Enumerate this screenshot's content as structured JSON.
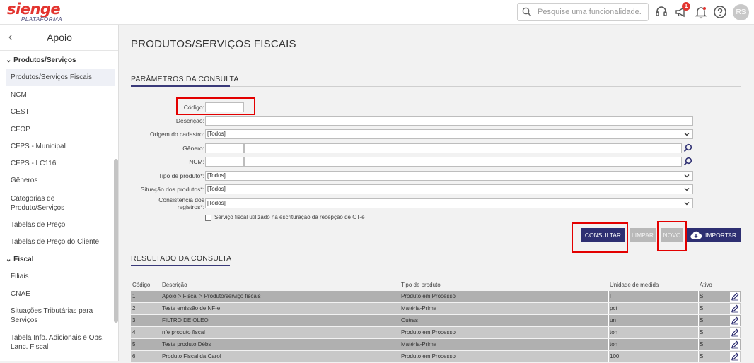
{
  "header": {
    "logo_main": "sienge",
    "logo_sub": "PLATAFORMA",
    "search_placeholder": "Pesquise uma funcionalidade.",
    "notification_count": "1",
    "user_initials": "RS"
  },
  "sidebar": {
    "title": "Apoio",
    "sections": [
      {
        "label": "Produtos/Serviços",
        "items": [
          "Produtos/Serviços Fiscais",
          "NCM",
          "CEST",
          "CFOP",
          "CFPS - Municipal",
          "CFPS - LC116",
          "Gêneros",
          "Categorias de Produto/Serviços",
          "Tabelas de Preço",
          "Tabelas de Preço do Cliente"
        ]
      },
      {
        "label": "Fiscal",
        "items": [
          "Filiais",
          "CNAE",
          "Situações Tributárias para Serviços",
          "Tabela Info. Adicionais e Obs. Lanc. Fiscal"
        ]
      }
    ]
  },
  "page": {
    "title": "PRODUTOS/SERVIÇOS FISCAIS",
    "params_title": "PARÂMETROS DA CONSULTA",
    "results_title": "RESULTADO DA CONSULTA"
  },
  "form": {
    "codigo_label": "Código:",
    "descricao_label": "Descrição:",
    "origem_label": "Origem do cadastro:",
    "origem_value": "[Todos]",
    "genero_label": "Gênero:",
    "ncm_label": "NCM:",
    "tipo_label": "Tipo de produto*:",
    "tipo_value": "[Todos]",
    "situacao_label": "Situação dos produtos*:",
    "situacao_value": "[Todos]",
    "consistencia_label": "Consistência dos registros*:",
    "consistencia_value": "[Todos]",
    "checkbox_label": "Serviço fiscal utilizado na escrituração da recepção de CT-e"
  },
  "buttons": {
    "consultar": "CONSULTAR",
    "limpar": "LIMPAR",
    "novo": "NOVO",
    "importar": "IMPORTAR"
  },
  "table": {
    "columns": [
      "Código",
      "Descrição",
      "Tipo de produto",
      "Unidade de medida",
      "Ativo"
    ],
    "rows": [
      {
        "codigo": "1",
        "descricao": "Apoio > Fiscal > Produto/serviço fiscais",
        "tipo": "Produto em Processo",
        "unidade": "l",
        "ativo": "S"
      },
      {
        "codigo": "2",
        "descricao": "Teste emissão de NF-e",
        "tipo": "Matéria-Prima",
        "unidade": "pct",
        "ativo": "S"
      },
      {
        "codigo": "3",
        "descricao": "FILTRO DE OLEO",
        "tipo": "Outras",
        "unidade": "un",
        "ativo": "S"
      },
      {
        "codigo": "4",
        "descricao": "nfe produto fiscal",
        "tipo": "Produto em Processo",
        "unidade": "ton",
        "ativo": "S"
      },
      {
        "codigo": "5",
        "descricao": "Teste produto Débs",
        "tipo": "Matéria-Prima",
        "unidade": "ton",
        "ativo": "S"
      },
      {
        "codigo": "6",
        "descricao": "Produto Fiscal da Carol",
        "tipo": "Produto em Processo",
        "unidade": "100",
        "ativo": "S"
      }
    ]
  },
  "colors": {
    "brand_red": "#e3342f",
    "primary_button": "#2e2f72",
    "highlight_box": "#e30000",
    "row_dark": "#b0b0b0",
    "row_light": "#c8c8c8"
  }
}
